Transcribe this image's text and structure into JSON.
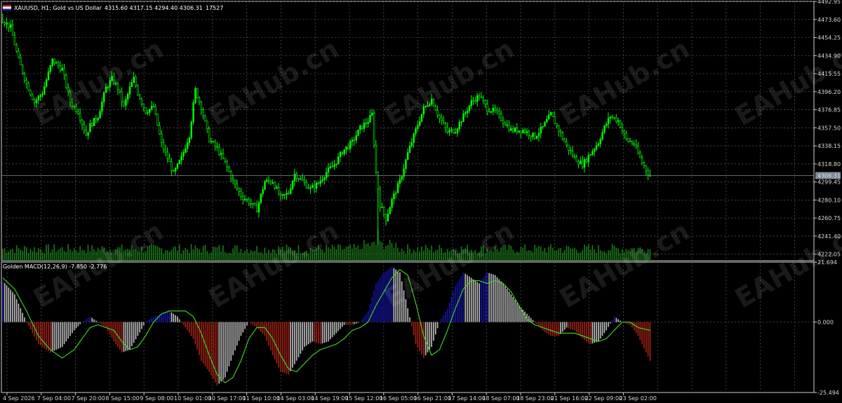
{
  "header": {
    "symbol_line": "XAUUSD, H1:  Gold vs US Dollar",
    "ohlc": "4315.60 4317.15 4294.40 4306.31",
    "volume": "17527"
  },
  "indicator": {
    "title": "Golden MACD(12,26,9) -7.850 -2.776"
  },
  "watermark": "EAHub.cn",
  "colors": {
    "bull": "#00ff00",
    "bear": "#00ff00",
    "volume": "#1b7a1b",
    "macd_up": "#1414a0",
    "macd_down": "#a02014",
    "macd_neutral": "#b8b8b8",
    "signal": "#44dd22",
    "grid": "#5a5a5a",
    "bid_line": "#7f8c99"
  },
  "chart_data": [
    {
      "type": "candlestick",
      "title": "XAUUSD, H1",
      "price_axis_ticks": [
        "4492.95",
        "4473.60",
        "4454.25",
        "4434.90",
        "4415.55",
        "4396.20",
        "4376.85",
        "4357.50",
        "4338.15",
        "4318.80",
        "4299.45",
        "4280.10",
        "4260.75",
        "4241.40",
        "4222.05"
      ],
      "current_price_label": "4306.31",
      "ylim": [
        4215,
        4493
      ],
      "time_axis_ticks": [
        "4 Sep 2026",
        "7 Sep 04:00",
        "7 Sep 20:00",
        "8 Sep 15:00",
        "9 Sep 08:00",
        "10 Sep 01:00",
        "10 Sep 17:00",
        "11 Sep 10:00",
        "14 Sep 03:00",
        "14 Sep 19:00",
        "15 Sep 12:00",
        "16 Sep 05:00",
        "16 Sep 21:00",
        "17 Sep 14:00",
        "18 Sep 07:00",
        "18 Sep 23:00",
        "21 Sep 16:00",
        "22 Sep 09:00",
        "23 Sep 02:00"
      ],
      "close_path": [
        [
          0,
          4473
        ],
        [
          4,
          4465
        ],
        [
          8,
          4430
        ],
        [
          12,
          4405
        ],
        [
          16,
          4385
        ],
        [
          20,
          4395
        ],
        [
          25,
          4430
        ],
        [
          30,
          4420
        ],
        [
          34,
          4385
        ],
        [
          38,
          4375
        ],
        [
          42,
          4350
        ],
        [
          44,
          4360
        ],
        [
          48,
          4370
        ],
        [
          52,
          4400
        ],
        [
          55,
          4410
        ],
        [
          58,
          4400
        ],
        [
          61,
          4380
        ],
        [
          64,
          4400
        ],
        [
          66,
          4410
        ],
        [
          68,
          4395
        ],
        [
          72,
          4375
        ],
        [
          76,
          4380
        ],
        [
          80,
          4340
        ],
        [
          84,
          4320
        ],
        [
          86,
          4308
        ],
        [
          90,
          4325
        ],
        [
          94,
          4350
        ],
        [
          97,
          4398
        ],
        [
          100,
          4380
        ],
        [
          104,
          4345
        ],
        [
          108,
          4335
        ],
        [
          112,
          4320
        ],
        [
          116,
          4300
        ],
        [
          120,
          4285
        ],
        [
          124,
          4278
        ],
        [
          128,
          4270
        ],
        [
          132,
          4300
        ],
        [
          136,
          4300
        ],
        [
          140,
          4282
        ],
        [
          144,
          4288
        ],
        [
          147,
          4308
        ],
        [
          151,
          4300
        ],
        [
          155,
          4292
        ],
        [
          159,
          4298
        ],
        [
          163,
          4310
        ],
        [
          167,
          4318
        ],
        [
          171,
          4332
        ],
        [
          176,
          4342
        ],
        [
          180,
          4357
        ],
        [
          184,
          4365
        ],
        [
          186,
          4372
        ],
        [
          188,
          4310
        ],
        [
          190,
          4275
        ],
        [
          193,
          4260
        ],
        [
          196,
          4280
        ],
        [
          200,
          4300
        ],
        [
          204,
          4330
        ],
        [
          208,
          4355
        ],
        [
          212,
          4378
        ],
        [
          216,
          4388
        ],
        [
          220,
          4368
        ],
        [
          224,
          4353
        ],
        [
          228,
          4355
        ],
        [
          232,
          4370
        ],
        [
          236,
          4385
        ],
        [
          240,
          4392
        ],
        [
          244,
          4378
        ],
        [
          248,
          4375
        ],
        [
          252,
          4365
        ],
        [
          256,
          4355
        ],
        [
          262,
          4355
        ],
        [
          268,
          4348
        ],
        [
          272,
          4358
        ],
        [
          276,
          4372
        ],
        [
          280,
          4355
        ],
        [
          284,
          4338
        ],
        [
          288,
          4325
        ],
        [
          292,
          4318
        ],
        [
          296,
          4330
        ],
        [
          300,
          4342
        ],
        [
          303,
          4358
        ],
        [
          306,
          4370
        ],
        [
          310,
          4365
        ],
        [
          314,
          4345
        ],
        [
          318,
          4340
        ],
        [
          322,
          4320
        ],
        [
          326,
          4306
        ]
      ],
      "bars_total": 327
    },
    {
      "type": "histogram+line",
      "title": "Golden MACD(12,26,9)",
      "macd": -7.85,
      "signal": -2.776,
      "y_axis_ticks": [
        "21.694",
        "0.000",
        "-25.494"
      ],
      "ylim": [
        -25.494,
        21.694
      ],
      "macd_path": [
        [
          0,
          15
        ],
        [
          6,
          10
        ],
        [
          12,
          0
        ],
        [
          18,
          -8
        ],
        [
          24,
          -11
        ],
        [
          30,
          -9
        ],
        [
          36,
          -3
        ],
        [
          40,
          0
        ],
        [
          44,
          2
        ],
        [
          48,
          0
        ],
        [
          52,
          -2
        ],
        [
          56,
          -7
        ],
        [
          60,
          -11
        ],
        [
          64,
          -10
        ],
        [
          68,
          -5
        ],
        [
          72,
          0
        ],
        [
          76,
          2
        ],
        [
          80,
          3
        ],
        [
          84,
          4
        ],
        [
          88,
          2
        ],
        [
          92,
          -2
        ],
        [
          96,
          -6
        ],
        [
          100,
          -14
        ],
        [
          104,
          -18
        ],
        [
          108,
          -23
        ],
        [
          112,
          -20
        ],
        [
          116,
          -12
        ],
        [
          120,
          -5
        ],
        [
          124,
          0
        ],
        [
          128,
          -2
        ],
        [
          132,
          -5
        ],
        [
          136,
          -12
        ],
        [
          140,
          -18
        ],
        [
          144,
          -19
        ],
        [
          148,
          -14
        ],
        [
          152,
          -9
        ],
        [
          156,
          -7
        ],
        [
          160,
          -8
        ],
        [
          164,
          -7
        ],
        [
          168,
          -4
        ],
        [
          172,
          -1
        ],
        [
          176,
          -1
        ],
        [
          180,
          0
        ],
        [
          184,
          4
        ],
        [
          188,
          14
        ],
        [
          192,
          18
        ],
        [
          196,
          20
        ],
        [
          200,
          18
        ],
        [
          204,
          5
        ],
        [
          208,
          -8
        ],
        [
          212,
          -13
        ],
        [
          216,
          -9
        ],
        [
          220,
          0
        ],
        [
          224,
          5
        ],
        [
          228,
          13
        ],
        [
          232,
          18
        ],
        [
          236,
          16
        ],
        [
          240,
          14
        ],
        [
          244,
          18
        ],
        [
          248,
          17
        ],
        [
          252,
          14
        ],
        [
          256,
          10
        ],
        [
          260,
          6
        ],
        [
          264,
          3
        ],
        [
          268,
          0
        ],
        [
          272,
          -3
        ],
        [
          276,
          -5
        ],
        [
          280,
          -5
        ],
        [
          284,
          -2
        ],
        [
          288,
          -3
        ],
        [
          292,
          -6
        ],
        [
          296,
          -8
        ],
        [
          300,
          -7
        ],
        [
          304,
          -3
        ],
        [
          308,
          2
        ],
        [
          312,
          0
        ],
        [
          316,
          -1
        ],
        [
          320,
          -5
        ],
        [
          326,
          -14
        ]
      ],
      "signal_path": [
        [
          0,
          16
        ],
        [
          6,
          12
        ],
        [
          12,
          4
        ],
        [
          18,
          -5
        ],
        [
          24,
          -10
        ],
        [
          30,
          -13
        ],
        [
          36,
          -10
        ],
        [
          40,
          -6
        ],
        [
          44,
          -2
        ],
        [
          48,
          -1
        ],
        [
          52,
          -2
        ],
        [
          56,
          -3
        ],
        [
          60,
          -7
        ],
        [
          64,
          -10
        ],
        [
          68,
          -9
        ],
        [
          72,
          -5
        ],
        [
          76,
          0
        ],
        [
          80,
          3
        ],
        [
          84,
          4
        ],
        [
          88,
          4
        ],
        [
          92,
          4
        ],
        [
          96,
          2
        ],
        [
          100,
          -4
        ],
        [
          104,
          -12
        ],
        [
          108,
          -19
        ],
        [
          112,
          -22
        ],
        [
          116,
          -20
        ],
        [
          120,
          -14
        ],
        [
          124,
          -6
        ],
        [
          128,
          -2
        ],
        [
          132,
          -2
        ],
        [
          136,
          -6
        ],
        [
          140,
          -12
        ],
        [
          144,
          -17
        ],
        [
          148,
          -18
        ],
        [
          152,
          -15
        ],
        [
          156,
          -12
        ],
        [
          160,
          -10
        ],
        [
          164,
          -9
        ],
        [
          168,
          -8
        ],
        [
          172,
          -6
        ],
        [
          176,
          -3
        ],
        [
          180,
          -2
        ],
        [
          184,
          0
        ],
        [
          188,
          6
        ],
        [
          192,
          11
        ],
        [
          196,
          16
        ],
        [
          200,
          19
        ],
        [
          204,
          17
        ],
        [
          208,
          7
        ],
        [
          212,
          -5
        ],
        [
          216,
          -12
        ],
        [
          220,
          -10
        ],
        [
          224,
          -3
        ],
        [
          228,
          5
        ],
        [
          232,
          12
        ],
        [
          236,
          15
        ],
        [
          240,
          15
        ],
        [
          244,
          14
        ],
        [
          248,
          15
        ],
        [
          252,
          14
        ],
        [
          256,
          11
        ],
        [
          260,
          6
        ],
        [
          264,
          1
        ],
        [
          268,
          -1
        ],
        [
          272,
          -2
        ],
        [
          276,
          -3
        ],
        [
          280,
          -4
        ],
        [
          284,
          -4
        ],
        [
          288,
          -4
        ],
        [
          292,
          -5
        ],
        [
          296,
          -6
        ],
        [
          300,
          -7
        ],
        [
          304,
          -6
        ],
        [
          308,
          -3
        ],
        [
          312,
          0
        ],
        [
          316,
          0
        ],
        [
          320,
          -2
        ],
        [
          326,
          -3
        ]
      ]
    }
  ]
}
